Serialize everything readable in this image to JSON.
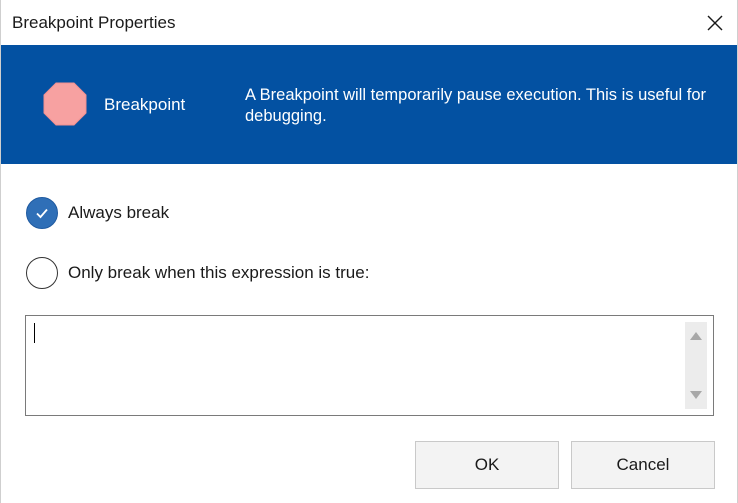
{
  "window": {
    "title": "Breakpoint Properties",
    "close_icon": "close-icon"
  },
  "banner": {
    "icon": "stop-octagon-icon",
    "icon_color": "#f7a1a1",
    "background": "#0351a2",
    "name": "Breakpoint",
    "description": "A Breakpoint will temporarily pause execution. This is useful for debugging."
  },
  "options": {
    "always_break": {
      "label": "Always break",
      "checked": true
    },
    "conditional_break": {
      "label": "Only break when this expression is true:",
      "checked": false
    }
  },
  "expression": {
    "value": ""
  },
  "buttons": {
    "ok_label": "OK",
    "cancel_label": "Cancel"
  }
}
